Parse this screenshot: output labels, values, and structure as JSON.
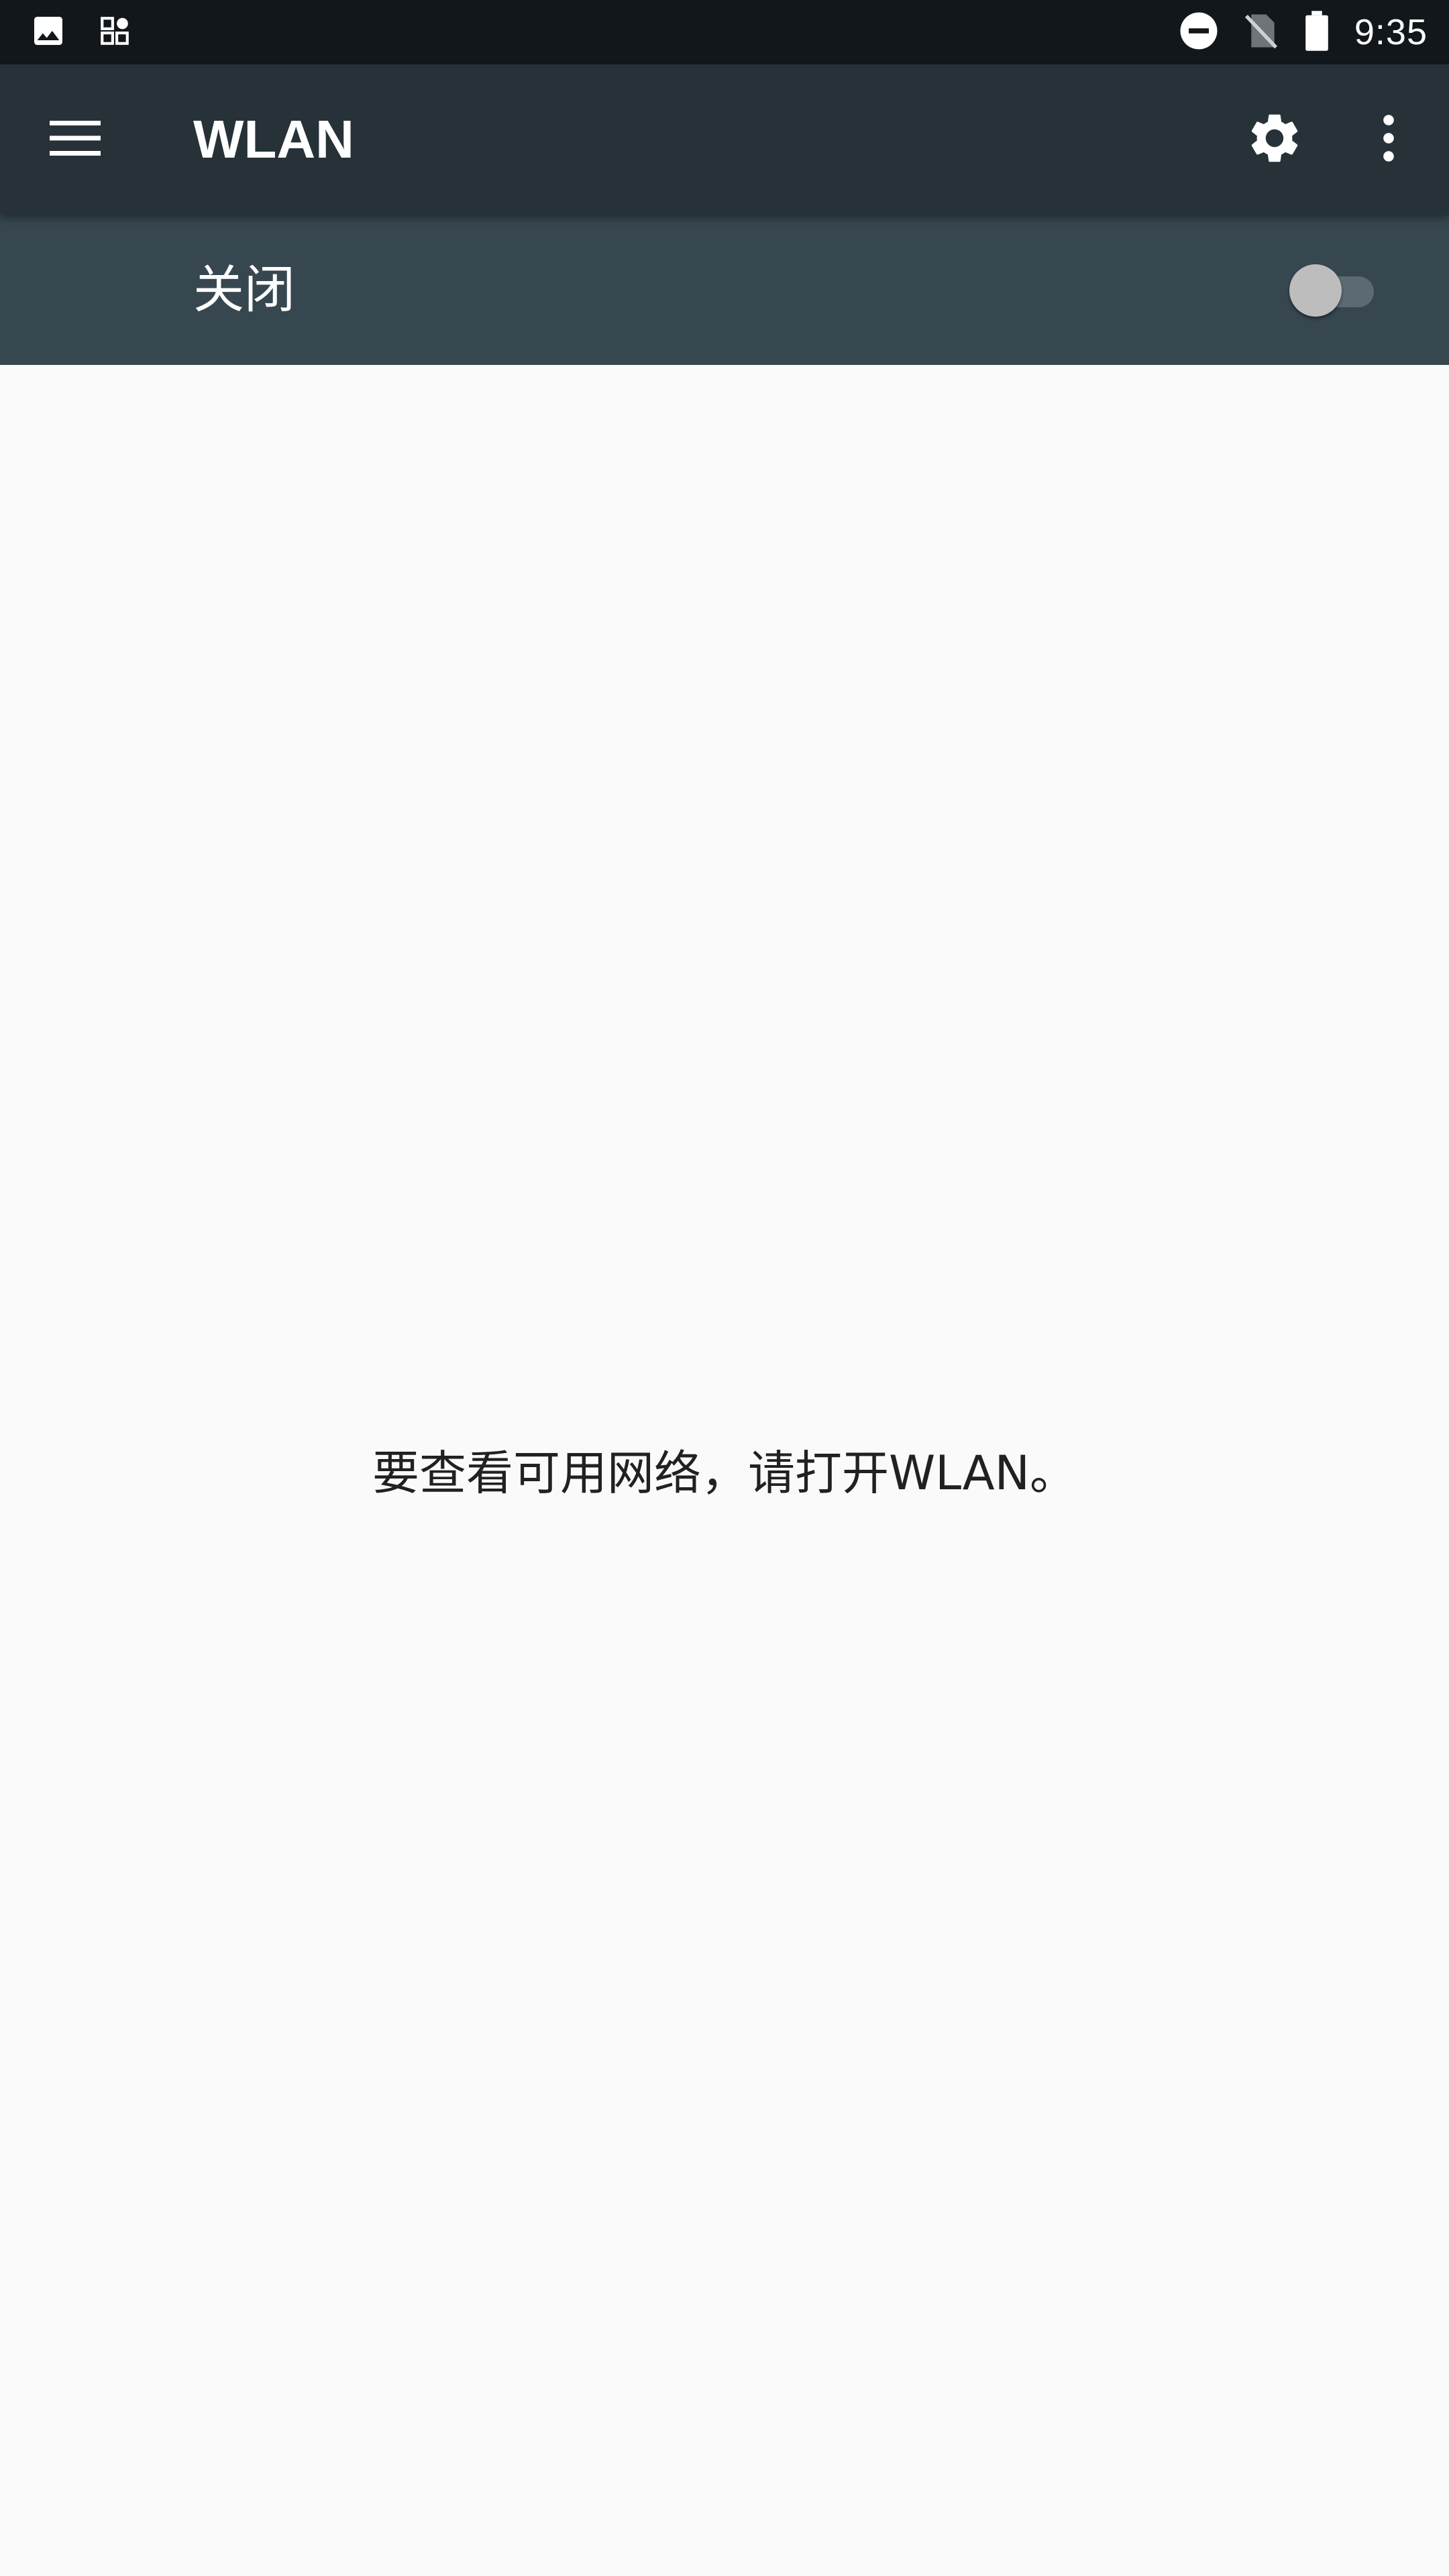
{
  "status_bar": {
    "time": "9:35",
    "icons": [
      "image-icon",
      "apps-grid-icon",
      "do-not-disturb-icon",
      "no-sim-icon",
      "battery-icon"
    ]
  },
  "app_bar": {
    "title": "WLAN",
    "icons": [
      "menu-icon",
      "gear-icon",
      "more-vert-icon"
    ],
    "background_color": "#263238"
  },
  "wifi_switch": {
    "label": "关闭",
    "checked": false,
    "background_color": "#37474f"
  },
  "main": {
    "empty_message": "要查看可用网络，请打开WLAN。"
  }
}
